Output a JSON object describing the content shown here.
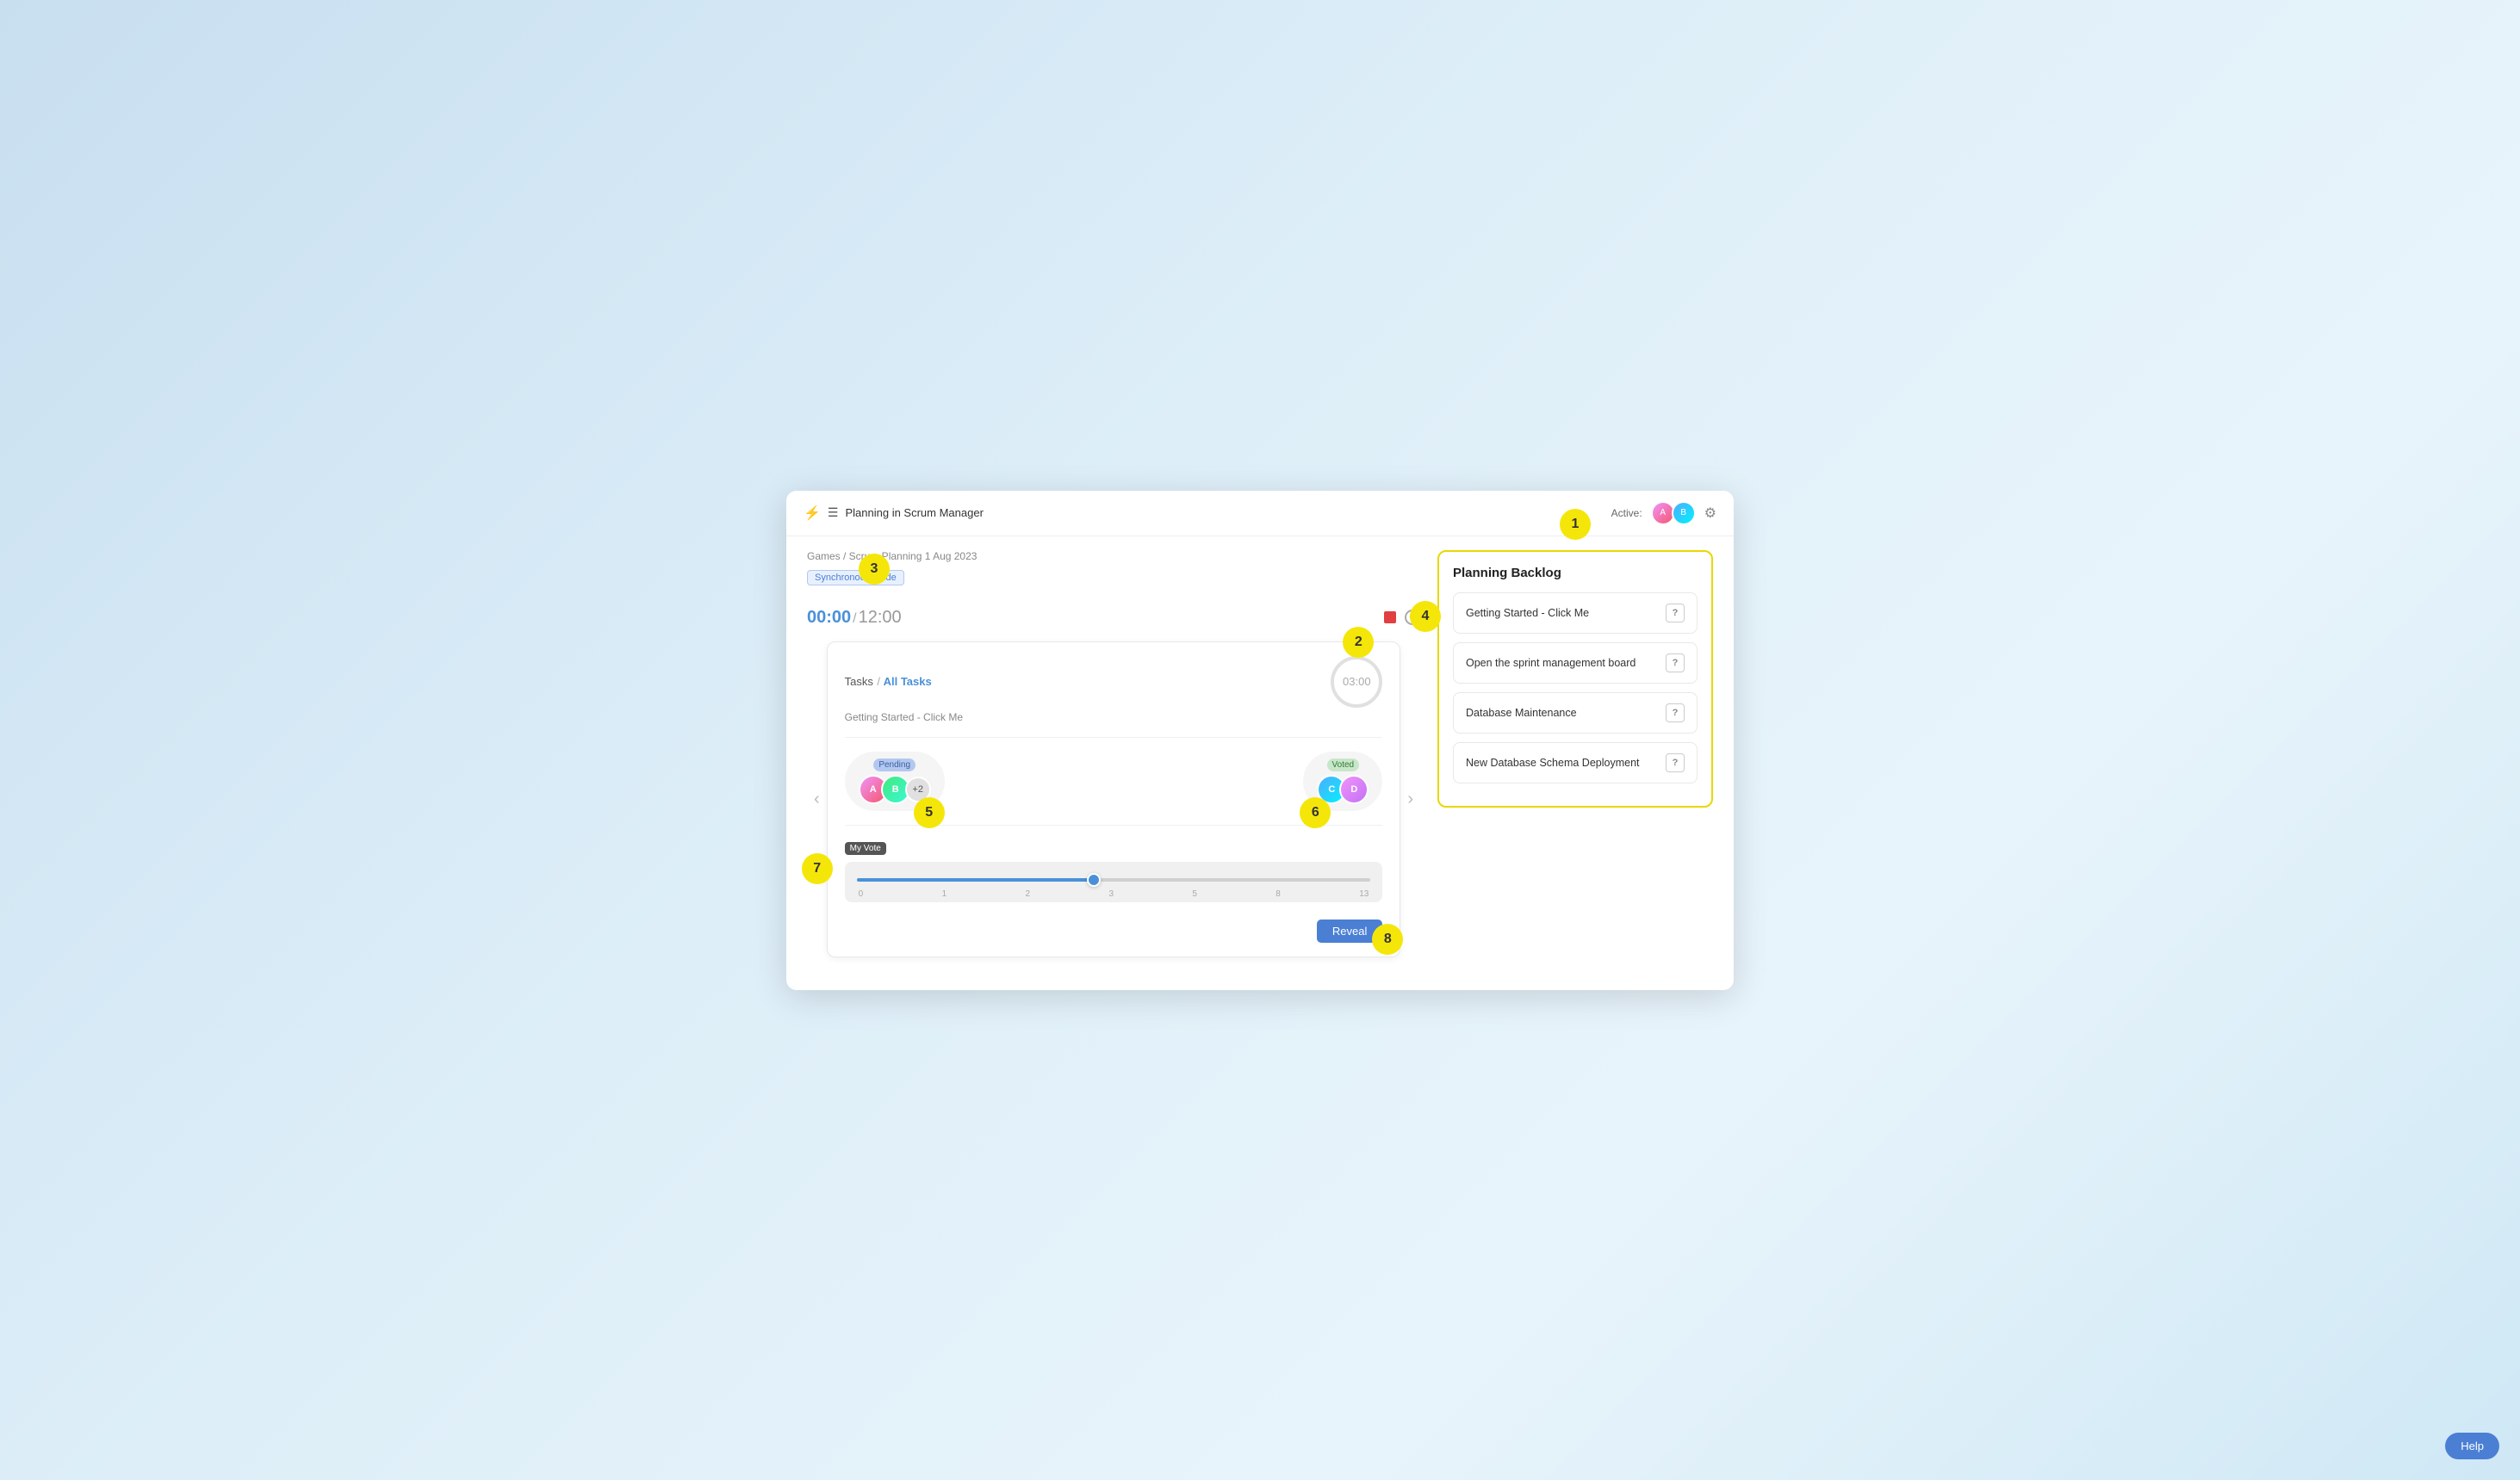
{
  "app": {
    "title": "Planning in Scrum Manager",
    "breadcrumb": "Games / Scrum Planning 1 Aug 2023",
    "sync_mode": "Synchronous Mode"
  },
  "header": {
    "active_label": "Active:",
    "settings_icon": "⚙"
  },
  "timer": {
    "current": "00:00",
    "separator": "/",
    "total": "12:00"
  },
  "task_card": {
    "tasks_label": "Tasks",
    "separator": "/",
    "all_tasks_label": "All Tasks",
    "task_name": "Getting Started - Click Me",
    "timer_value": "03:00",
    "pending_badge": "Pending",
    "voted_badge": "Voted",
    "pending_extra_count": "+2",
    "my_vote_label": "My Vote",
    "slider_ticks": [
      "0",
      "1",
      "2",
      "3",
      "5",
      "8",
      "13"
    ],
    "slider_value": 46,
    "reveal_label": "Reveal",
    "nav_prev": "‹",
    "nav_next": "›"
  },
  "backlog": {
    "title": "Planning Backlog",
    "items": [
      {
        "id": 1,
        "text": "Getting Started - Click Me",
        "icon": "?"
      },
      {
        "id": 2,
        "text": "Open the sprint management board",
        "icon": "?"
      },
      {
        "id": 3,
        "text": "Database Maintenance",
        "icon": "?"
      },
      {
        "id": 4,
        "text": "New Database Schema Deployment",
        "icon": "?"
      }
    ]
  },
  "annotations": [
    {
      "id": "1",
      "label": "1"
    },
    {
      "id": "2",
      "label": "2"
    },
    {
      "id": "3",
      "label": "3"
    },
    {
      "id": "4",
      "label": "4"
    },
    {
      "id": "5",
      "label": "5"
    },
    {
      "id": "6",
      "label": "6"
    },
    {
      "id": "7",
      "label": "7"
    },
    {
      "id": "8",
      "label": "8"
    }
  ],
  "help": {
    "label": "Help"
  }
}
